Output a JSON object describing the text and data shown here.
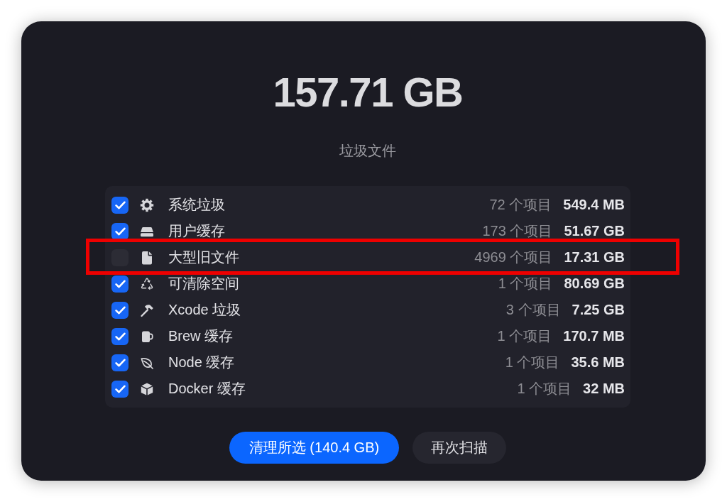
{
  "summary": {
    "total": "157.71 GB",
    "caption": "垃圾文件"
  },
  "rows": [
    {
      "label": "系统垃圾",
      "count": "72 个项目",
      "size": "549.4 MB",
      "checked": true,
      "highlighted": false
    },
    {
      "label": "用户缓存",
      "count": "173 个项目",
      "size": "51.67 GB",
      "checked": true,
      "highlighted": false
    },
    {
      "label": "大型旧文件",
      "count": "4969 个项目",
      "size": "17.31 GB",
      "checked": false,
      "highlighted": true
    },
    {
      "label": "可清除空间",
      "count": "1 个项目",
      "size": "80.69 GB",
      "checked": true,
      "highlighted": false
    },
    {
      "label": "Xcode 垃圾",
      "count": "3 个项目",
      "size": "7.25 GB",
      "checked": true,
      "highlighted": false
    },
    {
      "label": "Brew 缓存",
      "count": "1 个项目",
      "size": "170.7 MB",
      "checked": true,
      "highlighted": false
    },
    {
      "label": "Node 缓存",
      "count": "1 个项目",
      "size": "35.6 MB",
      "checked": true,
      "highlighted": false
    },
    {
      "label": "Docker 缓存",
      "count": "1 个项目",
      "size": "32 MB",
      "checked": true,
      "highlighted": false
    }
  ],
  "buttons": [
    {
      "label": "清理所选 (140.4 GB)",
      "kind": "primary"
    },
    {
      "label": "再次扫描",
      "kind": "secondary"
    }
  ]
}
